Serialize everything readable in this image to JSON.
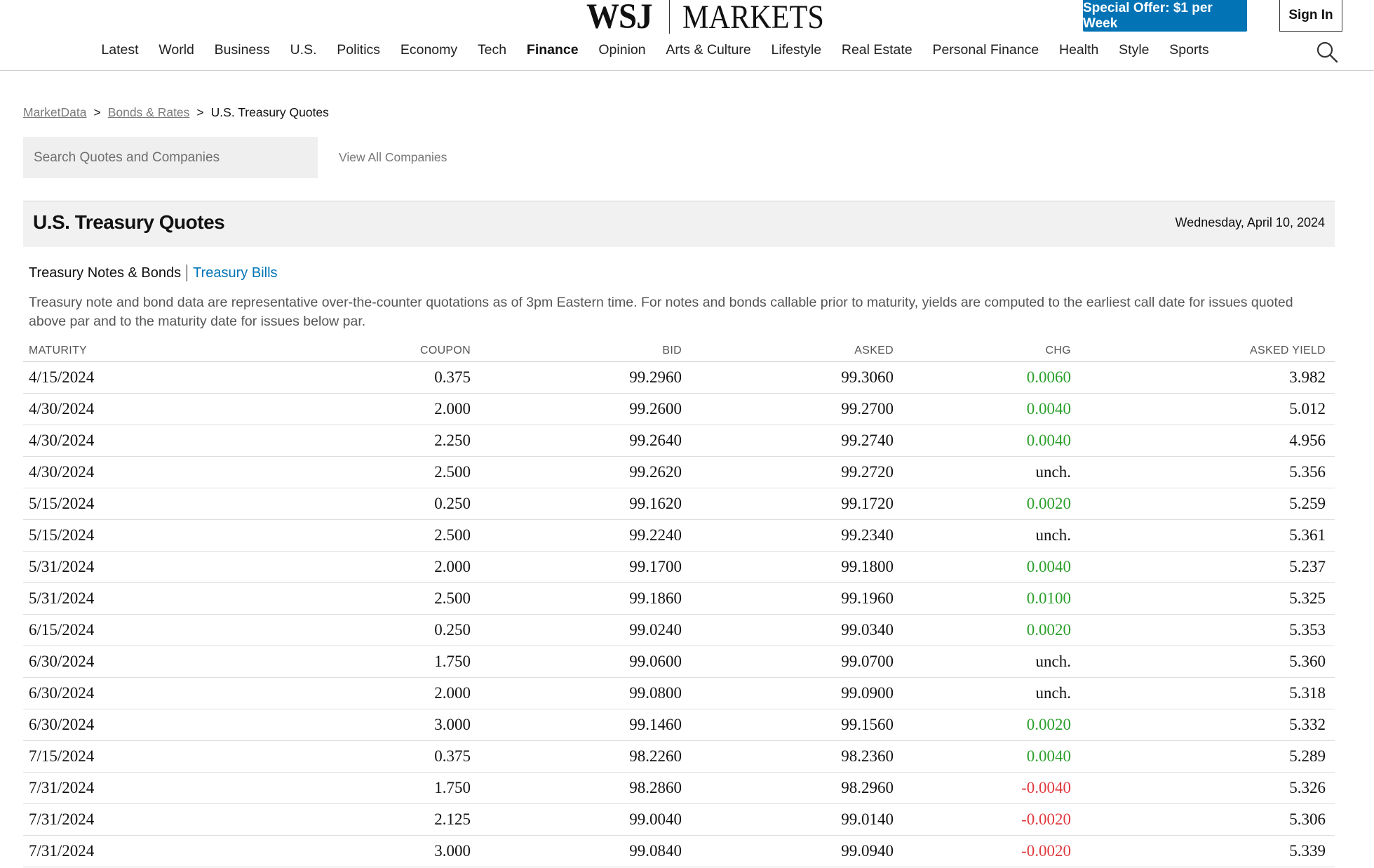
{
  "header": {
    "logo_wsj": "WSJ",
    "logo_section": "MARKETS",
    "offer_label": "Special Offer: $1 per Week",
    "signin_label": "Sign In",
    "nav": [
      {
        "label": "Latest"
      },
      {
        "label": "World"
      },
      {
        "label": "Business"
      },
      {
        "label": "U.S."
      },
      {
        "label": "Politics"
      },
      {
        "label": "Economy"
      },
      {
        "label": "Tech"
      },
      {
        "label": "Finance",
        "active": true
      },
      {
        "label": "Opinion"
      },
      {
        "label": "Arts & Culture"
      },
      {
        "label": "Lifestyle"
      },
      {
        "label": "Real Estate"
      },
      {
        "label": "Personal Finance"
      },
      {
        "label": "Health"
      },
      {
        "label": "Style"
      },
      {
        "label": "Sports"
      }
    ],
    "search_icon": "search-icon"
  },
  "breadcrumb": {
    "items": [
      "MarketData",
      "Bonds & Rates",
      "U.S. Treasury Quotes"
    ],
    "separator": ">"
  },
  "search": {
    "placeholder": "Search Quotes and Companies",
    "value": "",
    "view_all": "View All Companies"
  },
  "title_bar": {
    "title": "U.S. Treasury Quotes",
    "date": "Wednesday, April 10, 2024"
  },
  "tabs": {
    "active": "Treasury Notes & Bonds",
    "other": "Treasury Bills"
  },
  "description": "Treasury note and bond data are representative over-the-counter quotations as of 3pm Eastern time. For notes and bonds callable prior to maturity, yields are computed to the earliest call date for issues quoted above par and to the maturity date for issues below par.",
  "table": {
    "columns": [
      "MATURITY",
      "COUPON",
      "BID",
      "ASKED",
      "CHG",
      "ASKED YIELD"
    ],
    "rows": [
      [
        "4/15/2024",
        "0.375",
        "99.2960",
        "99.3060",
        "0.0060",
        "3.982"
      ],
      [
        "4/30/2024",
        "2.000",
        "99.2600",
        "99.2700",
        "0.0040",
        "5.012"
      ],
      [
        "4/30/2024",
        "2.250",
        "99.2640",
        "99.2740",
        "0.0040",
        "4.956"
      ],
      [
        "4/30/2024",
        "2.500",
        "99.2620",
        "99.2720",
        "unch.",
        "5.356"
      ],
      [
        "5/15/2024",
        "0.250",
        "99.1620",
        "99.1720",
        "0.0020",
        "5.259"
      ],
      [
        "5/15/2024",
        "2.500",
        "99.2240",
        "99.2340",
        "unch.",
        "5.361"
      ],
      [
        "5/31/2024",
        "2.000",
        "99.1700",
        "99.1800",
        "0.0040",
        "5.237"
      ],
      [
        "5/31/2024",
        "2.500",
        "99.1860",
        "99.1960",
        "0.0100",
        "5.325"
      ],
      [
        "6/15/2024",
        "0.250",
        "99.0240",
        "99.0340",
        "0.0020",
        "5.353"
      ],
      [
        "6/30/2024",
        "1.750",
        "99.0600",
        "99.0700",
        "unch.",
        "5.360"
      ],
      [
        "6/30/2024",
        "2.000",
        "99.0800",
        "99.0900",
        "unch.",
        "5.318"
      ],
      [
        "6/30/2024",
        "3.000",
        "99.1460",
        "99.1560",
        "0.0020",
        "5.332"
      ],
      [
        "7/15/2024",
        "0.375",
        "98.2260",
        "98.2360",
        "0.0040",
        "5.289"
      ],
      [
        "7/31/2024",
        "1.750",
        "98.2860",
        "98.2960",
        "-0.0040",
        "5.326"
      ],
      [
        "7/31/2024",
        "2.125",
        "99.0040",
        "99.0140",
        "-0.0020",
        "5.306"
      ],
      [
        "7/31/2024",
        "3.000",
        "99.0840",
        "99.0940",
        "-0.0020",
        "5.339"
      ]
    ]
  },
  "colors": {
    "brand_blue": "#0274b6",
    "positive": "#2aa02a",
    "negative": "#e0393e"
  }
}
